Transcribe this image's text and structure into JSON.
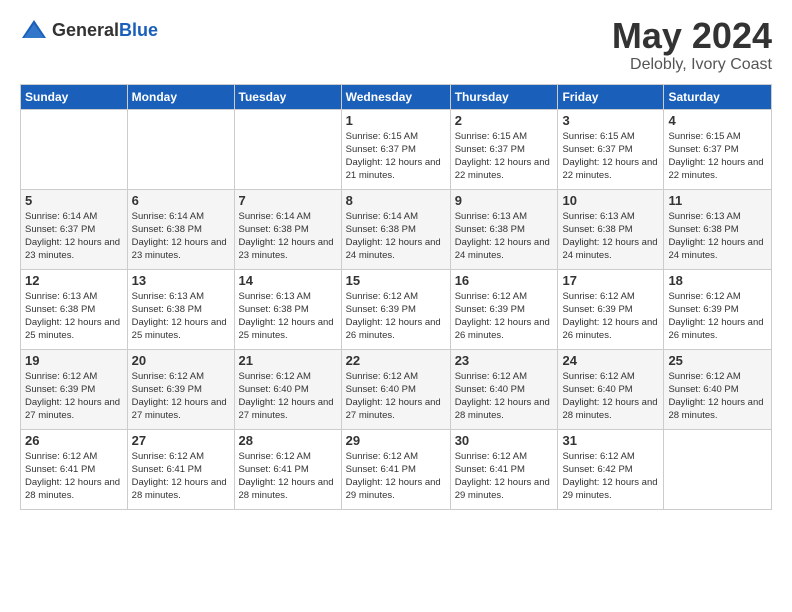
{
  "header": {
    "logo_general": "General",
    "logo_blue": "Blue",
    "title": "May 2024",
    "location": "Delobly, Ivory Coast"
  },
  "weekdays": [
    "Sunday",
    "Monday",
    "Tuesday",
    "Wednesday",
    "Thursday",
    "Friday",
    "Saturday"
  ],
  "weeks": [
    [
      {
        "day": "",
        "sunrise": "",
        "sunset": "",
        "daylight": ""
      },
      {
        "day": "",
        "sunrise": "",
        "sunset": "",
        "daylight": ""
      },
      {
        "day": "",
        "sunrise": "",
        "sunset": "",
        "daylight": ""
      },
      {
        "day": "1",
        "sunrise": "Sunrise: 6:15 AM",
        "sunset": "Sunset: 6:37 PM",
        "daylight": "Daylight: 12 hours and 21 minutes."
      },
      {
        "day": "2",
        "sunrise": "Sunrise: 6:15 AM",
        "sunset": "Sunset: 6:37 PM",
        "daylight": "Daylight: 12 hours and 22 minutes."
      },
      {
        "day": "3",
        "sunrise": "Sunrise: 6:15 AM",
        "sunset": "Sunset: 6:37 PM",
        "daylight": "Daylight: 12 hours and 22 minutes."
      },
      {
        "day": "4",
        "sunrise": "Sunrise: 6:15 AM",
        "sunset": "Sunset: 6:37 PM",
        "daylight": "Daylight: 12 hours and 22 minutes."
      }
    ],
    [
      {
        "day": "5",
        "sunrise": "Sunrise: 6:14 AM",
        "sunset": "Sunset: 6:37 PM",
        "daylight": "Daylight: 12 hours and 23 minutes."
      },
      {
        "day": "6",
        "sunrise": "Sunrise: 6:14 AM",
        "sunset": "Sunset: 6:38 PM",
        "daylight": "Daylight: 12 hours and 23 minutes."
      },
      {
        "day": "7",
        "sunrise": "Sunrise: 6:14 AM",
        "sunset": "Sunset: 6:38 PM",
        "daylight": "Daylight: 12 hours and 23 minutes."
      },
      {
        "day": "8",
        "sunrise": "Sunrise: 6:14 AM",
        "sunset": "Sunset: 6:38 PM",
        "daylight": "Daylight: 12 hours and 24 minutes."
      },
      {
        "day": "9",
        "sunrise": "Sunrise: 6:13 AM",
        "sunset": "Sunset: 6:38 PM",
        "daylight": "Daylight: 12 hours and 24 minutes."
      },
      {
        "day": "10",
        "sunrise": "Sunrise: 6:13 AM",
        "sunset": "Sunset: 6:38 PM",
        "daylight": "Daylight: 12 hours and 24 minutes."
      },
      {
        "day": "11",
        "sunrise": "Sunrise: 6:13 AM",
        "sunset": "Sunset: 6:38 PM",
        "daylight": "Daylight: 12 hours and 24 minutes."
      }
    ],
    [
      {
        "day": "12",
        "sunrise": "Sunrise: 6:13 AM",
        "sunset": "Sunset: 6:38 PM",
        "daylight": "Daylight: 12 hours and 25 minutes."
      },
      {
        "day": "13",
        "sunrise": "Sunrise: 6:13 AM",
        "sunset": "Sunset: 6:38 PM",
        "daylight": "Daylight: 12 hours and 25 minutes."
      },
      {
        "day": "14",
        "sunrise": "Sunrise: 6:13 AM",
        "sunset": "Sunset: 6:38 PM",
        "daylight": "Daylight: 12 hours and 25 minutes."
      },
      {
        "day": "15",
        "sunrise": "Sunrise: 6:12 AM",
        "sunset": "Sunset: 6:39 PM",
        "daylight": "Daylight: 12 hours and 26 minutes."
      },
      {
        "day": "16",
        "sunrise": "Sunrise: 6:12 AM",
        "sunset": "Sunset: 6:39 PM",
        "daylight": "Daylight: 12 hours and 26 minutes."
      },
      {
        "day": "17",
        "sunrise": "Sunrise: 6:12 AM",
        "sunset": "Sunset: 6:39 PM",
        "daylight": "Daylight: 12 hours and 26 minutes."
      },
      {
        "day": "18",
        "sunrise": "Sunrise: 6:12 AM",
        "sunset": "Sunset: 6:39 PM",
        "daylight": "Daylight: 12 hours and 26 minutes."
      }
    ],
    [
      {
        "day": "19",
        "sunrise": "Sunrise: 6:12 AM",
        "sunset": "Sunset: 6:39 PM",
        "daylight": "Daylight: 12 hours and 27 minutes."
      },
      {
        "day": "20",
        "sunrise": "Sunrise: 6:12 AM",
        "sunset": "Sunset: 6:39 PM",
        "daylight": "Daylight: 12 hours and 27 minutes."
      },
      {
        "day": "21",
        "sunrise": "Sunrise: 6:12 AM",
        "sunset": "Sunset: 6:40 PM",
        "daylight": "Daylight: 12 hours and 27 minutes."
      },
      {
        "day": "22",
        "sunrise": "Sunrise: 6:12 AM",
        "sunset": "Sunset: 6:40 PM",
        "daylight": "Daylight: 12 hours and 27 minutes."
      },
      {
        "day": "23",
        "sunrise": "Sunrise: 6:12 AM",
        "sunset": "Sunset: 6:40 PM",
        "daylight": "Daylight: 12 hours and 28 minutes."
      },
      {
        "day": "24",
        "sunrise": "Sunrise: 6:12 AM",
        "sunset": "Sunset: 6:40 PM",
        "daylight": "Daylight: 12 hours and 28 minutes."
      },
      {
        "day": "25",
        "sunrise": "Sunrise: 6:12 AM",
        "sunset": "Sunset: 6:40 PM",
        "daylight": "Daylight: 12 hours and 28 minutes."
      }
    ],
    [
      {
        "day": "26",
        "sunrise": "Sunrise: 6:12 AM",
        "sunset": "Sunset: 6:41 PM",
        "daylight": "Daylight: 12 hours and 28 minutes."
      },
      {
        "day": "27",
        "sunrise": "Sunrise: 6:12 AM",
        "sunset": "Sunset: 6:41 PM",
        "daylight": "Daylight: 12 hours and 28 minutes."
      },
      {
        "day": "28",
        "sunrise": "Sunrise: 6:12 AM",
        "sunset": "Sunset: 6:41 PM",
        "daylight": "Daylight: 12 hours and 28 minutes."
      },
      {
        "day": "29",
        "sunrise": "Sunrise: 6:12 AM",
        "sunset": "Sunset: 6:41 PM",
        "daylight": "Daylight: 12 hours and 29 minutes."
      },
      {
        "day": "30",
        "sunrise": "Sunrise: 6:12 AM",
        "sunset": "Sunset: 6:41 PM",
        "daylight": "Daylight: 12 hours and 29 minutes."
      },
      {
        "day": "31",
        "sunrise": "Sunrise: 6:12 AM",
        "sunset": "Sunset: 6:42 PM",
        "daylight": "Daylight: 12 hours and 29 minutes."
      },
      {
        "day": "",
        "sunrise": "",
        "sunset": "",
        "daylight": ""
      }
    ]
  ]
}
